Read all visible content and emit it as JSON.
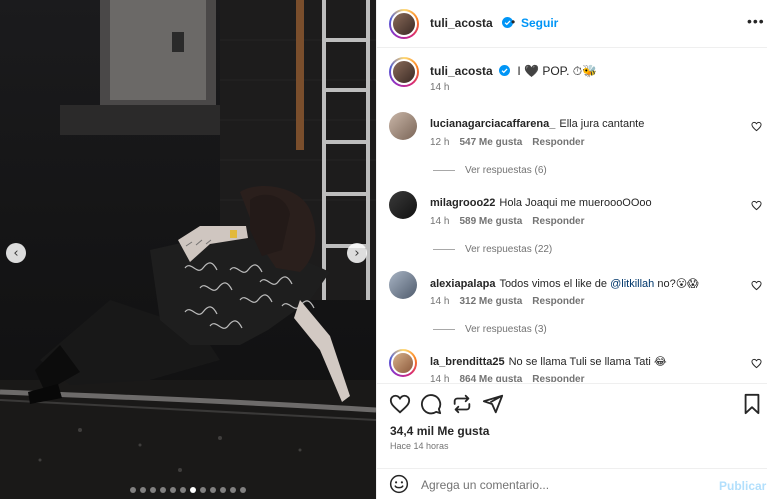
{
  "post": {
    "author": "tuli_acosta",
    "follow_label": "Seguir",
    "separator": "•",
    "more_icon": "more-horizontal-icon",
    "caption_text": "I 🖤 POP. ⏱🐝",
    "caption_time": "14 h",
    "likes_total": "34,4 mil Me gusta",
    "posted_ago": "Hace 14 horas",
    "accent_color": "#0095f6"
  },
  "carousel": {
    "slide_count": 12,
    "active_index": 6,
    "prev_icon": "chevron-left-icon",
    "next_icon": "chevron-right-icon"
  },
  "comments": [
    {
      "user": "lucianagarciacaffarena_",
      "text": "Ella jura cantante",
      "time": "12 h",
      "likes": "547 Me gusta",
      "reply": "Responder",
      "replies": "Ver respuestas (6)"
    },
    {
      "user": "milagrooo22",
      "text": "Hola Joaqui me mueroooOOoo",
      "time": "14 h",
      "likes": "589 Me gusta",
      "reply": "Responder",
      "replies": "Ver respuestas (22)"
    },
    {
      "user": "alexiapalapa",
      "text_before": "Todos vimos el like de",
      "mention": "@litkillah",
      "text_after": "no?😮😱",
      "time": "14 h",
      "likes": "312 Me gusta",
      "reply": "Responder",
      "replies": "Ver respuestas (3)"
    },
    {
      "user": "la_brenditta25",
      "text": "No se llama Tuli se llama Tati 😂",
      "time": "14 h",
      "likes": "864 Me gusta",
      "reply": "Responder"
    }
  ],
  "actions": {
    "like_icon": "heart-icon",
    "comment_icon": "comment-icon",
    "share_icon": "repost-icon",
    "send_icon": "send-icon",
    "save_icon": "bookmark-icon"
  },
  "composer": {
    "emoji_icon": "emoji-icon",
    "placeholder": "Agrega un comentario...",
    "publish_label": "Publicar"
  }
}
